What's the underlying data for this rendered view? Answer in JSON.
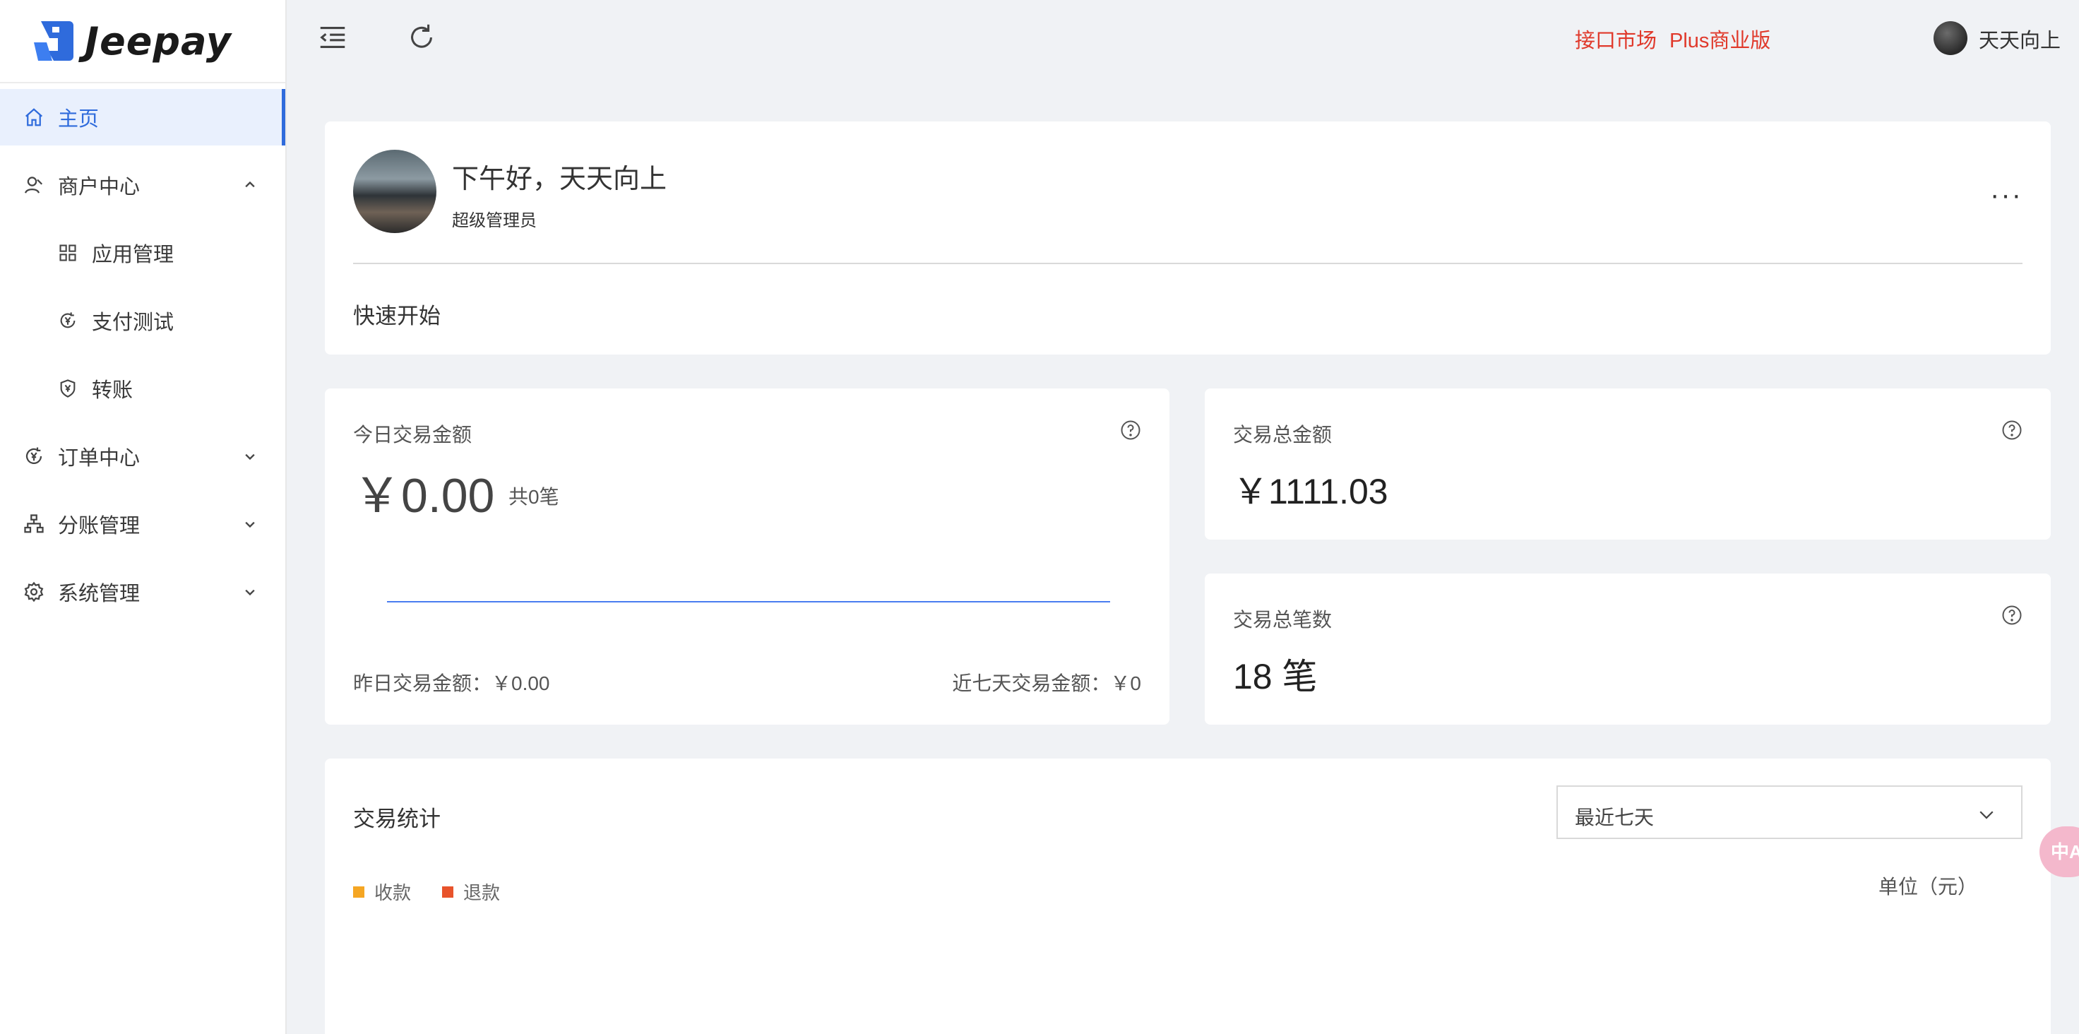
{
  "app": {
    "logo_text": "Jeepay",
    "brand_color": "#2f6bdc"
  },
  "sidebar": {
    "items": [
      {
        "label": "主页",
        "icon": "home-icon",
        "active": true
      },
      {
        "label": "商户中心",
        "icon": "user-icon",
        "expanded": true
      },
      {
        "label": "应用管理",
        "icon": "grid-icon",
        "sub": true
      },
      {
        "label": "支付测试",
        "icon": "yen-cycle-icon",
        "sub": true
      },
      {
        "label": "转账",
        "icon": "shield-yen-icon",
        "sub": true
      },
      {
        "label": "订单中心",
        "icon": "yen-cycle-icon",
        "expanded": false
      },
      {
        "label": "分账管理",
        "icon": "org-chart-icon",
        "expanded": false
      },
      {
        "label": "系统管理",
        "icon": "gear-icon",
        "expanded": false
      }
    ]
  },
  "topbar": {
    "link_market": "接口市场",
    "link_plus": "Plus商业版",
    "username": "天天向上",
    "link_color": "#e0392b"
  },
  "greeting": {
    "title": "下午好，天天向上",
    "role": "超级管理员",
    "more": "···",
    "quick_start": "快速开始"
  },
  "today": {
    "label": "今日交易金额",
    "value": "￥0.00",
    "count": "共0笔",
    "yesterday": "昨日交易金额：￥0.00",
    "last7": "近七天交易金额：￥0"
  },
  "total_amount": {
    "label": "交易总金额",
    "value": "￥1111.03"
  },
  "total_count": {
    "label": "交易总笔数",
    "value": "18 笔"
  },
  "stats": {
    "title": "交易统计",
    "range": "最近七天",
    "legend": [
      {
        "name": "收款",
        "color": "#f5a623"
      },
      {
        "name": "退款",
        "color": "#e8532b"
      }
    ],
    "unit": "单位（元）"
  },
  "float_button": {
    "label": "中A"
  }
}
